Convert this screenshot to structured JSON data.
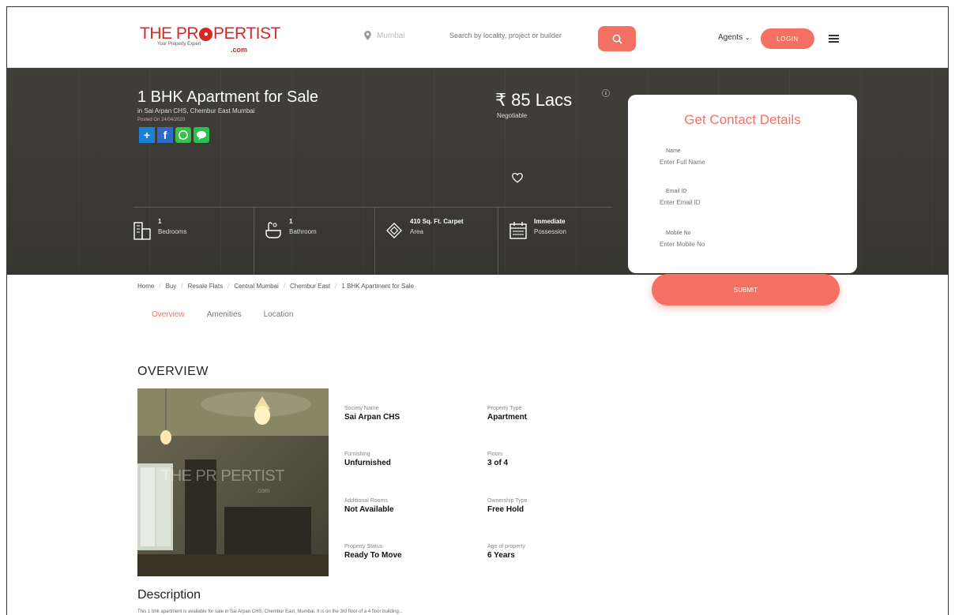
{
  "header": {
    "logo": {
      "text_before": "THE PR",
      "text_after": "PERTIST",
      "tagline": "Your Property Expert",
      "suffix": ".com"
    },
    "location": "Mumbai",
    "search_placeholder": "Search by locality, project or builder",
    "agents_label": "Agents",
    "login_label": "LOGIN"
  },
  "hero": {
    "title": "1 BHK Apartment for Sale",
    "subtitle": "in Sai Arpan CHS, Chembur East Mumbai",
    "posted": "Posted On 24/04/2020",
    "price": "₹ 85 Lacs",
    "price_note": "Negotiable",
    "stats": [
      {
        "value": "1",
        "label": "Bedrooms"
      },
      {
        "value": "1",
        "label": "Bathroom"
      },
      {
        "value": "410 Sq. Ft. Carpet",
        "label": "Area"
      },
      {
        "value": "Immediate",
        "label": "Possession"
      }
    ]
  },
  "contact": {
    "title": "Get Contact Details",
    "fields": [
      {
        "label": "Name",
        "placeholder": "Enter Full Name"
      },
      {
        "label": "Email ID",
        "placeholder": "Enter Email ID"
      },
      {
        "label": "Mobile No",
        "placeholder": "Enter Mobile No"
      }
    ],
    "submit_label": "SUBMIT"
  },
  "breadcrumb": [
    "Home",
    "Buy",
    "Resale Flats",
    "Central Mumbai",
    "Chembur East",
    "1 BHK Apartment for Sale"
  ],
  "tabs": [
    {
      "label": "Overview",
      "active": true
    },
    {
      "label": "Amenities",
      "active": false
    },
    {
      "label": "Location",
      "active": false
    }
  ],
  "overview": {
    "title": "OVERVIEW",
    "photo_watermark": "THE PR PERTIST",
    "photo_watermark_suffix": ".com",
    "details": [
      {
        "label": "Society Name",
        "value": "Sai Arpan CHS"
      },
      {
        "label": "Property Type",
        "value": "Apartment"
      },
      {
        "label": "Furnishing",
        "value": "Unfurnished"
      },
      {
        "label": "Floors",
        "value": "3 of 4"
      },
      {
        "label": "Additional Rooms",
        "value": "Not Available"
      },
      {
        "label": "Ownership Type",
        "value": "Free Hold"
      },
      {
        "label": "Property Status",
        "value": "Ready To Move"
      },
      {
        "label": "Age of property",
        "value": "6 Years"
      }
    ]
  },
  "description": {
    "title": "Description",
    "text": "This 1 bhk apartment is available for sale in Sai Arpan CHS, Chembur East, Mumbai. It is on the 3rd floor of a 4 floor building..."
  },
  "colors": {
    "accent": "#f27163",
    "hero_bg": "#3b3a36",
    "logo_red": "#d62828"
  }
}
